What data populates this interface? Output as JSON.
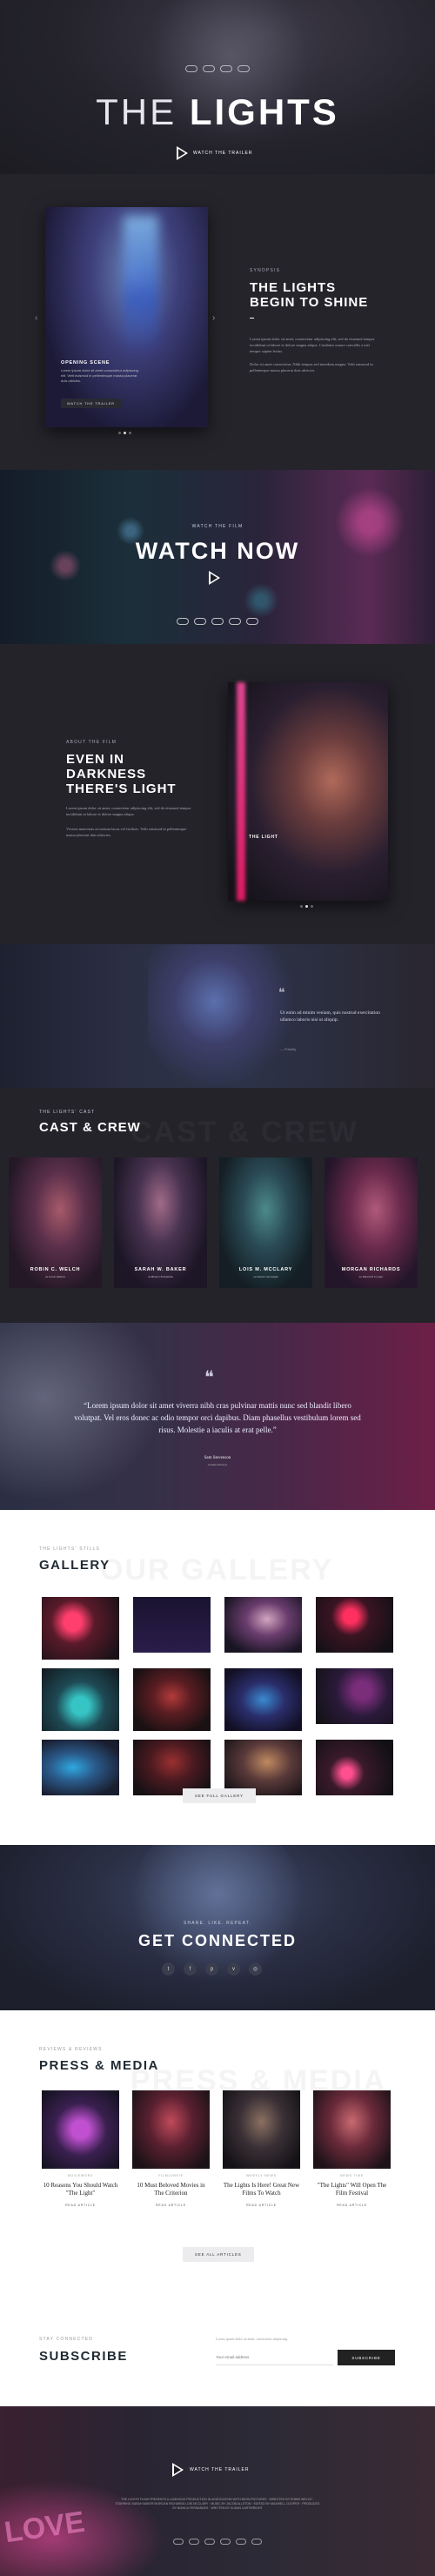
{
  "hero": {
    "title_thin": "THE",
    "title_bold": "LIGHTS",
    "trailer_label": "WATCH THE TRAILER",
    "award_count": 4
  },
  "story": {
    "eyebrow": "SYNOPSIS",
    "heading": "THE LIGHTS BEGIN TO SHINE",
    "body": [
      "Lorem ipsum dolor sit amet, consectetur adipiscing elit, sed do eiusmod tempor incididunt ut labore et dolore magna aliqua. Curabitur ornare convallis a nisl tempor sapien lectus.",
      "Dolor sit amet consectetur. Nibh tempus sed interdum magna. Velit euismod in pellentesque massa placerat duis ultricies."
    ],
    "slide": {
      "title": "OPENING SCENE",
      "desc": "Lorem ipsum dolor sit amet consectetur adipiscing elit. Velit euismod in pellentesque massa placerat duis ultricies.",
      "button": "WATCH THE TRAILER"
    },
    "dots": 3,
    "active_dot": 1
  },
  "watch": {
    "eyebrow": "WATCH THE FILM",
    "heading": "WATCH NOW",
    "award_count": 5
  },
  "about": {
    "eyebrow": "ABOUT THE FILM",
    "heading": "EVEN IN DARKNESS THERE'S LIGHT",
    "body": [
      "Lorem ipsum dolor sit amet, consectetur adipiscing elit, sed do eiusmod tempor incididunt ut labore et dolore magna aliqua.",
      "Viverra maecenas accumsan lacus vel facilisis. Velit euismod in pellentesque massa placerat duis ultricies."
    ],
    "photo_caption": "THE LIGHT",
    "dots": 3,
    "active_dot": 1
  },
  "quote1": {
    "text": "Ut enim ad minim veniam, quis nostrud exercitation ullamco laboris nisi ut aliquip.",
    "by": "— Freshly"
  },
  "cast": {
    "eyebrow": "THE LIGHTS' CAST",
    "heading": "CAST & CREW",
    "bg_word": "CAST & CREW",
    "members": [
      {
        "name": "ROBIN C. WELCH",
        "role": "as Jacob Allston"
      },
      {
        "name": "SARAH W. BAKER",
        "role": "as Bianca Fernandes"
      },
      {
        "name": "LOIS M. MCCLARY",
        "role": "as Susan Cartwright"
      },
      {
        "name": "MORGAN RICHARDS",
        "role": "as Maxwell Cooper"
      }
    ]
  },
  "quote2": {
    "text": "“Lorem ipsum dolor sit amet viverra nibh cras pulvinar mattis nunc sed blandit libero volutpat. Vel eros donec ac odio tempor orci dapibus. Diam phasellus vestibulum lorem sed risus. Molestie a iaculis at erat pelle.”",
    "by": "Sam Stevenson",
    "role": "Cinema Review"
  },
  "gallery": {
    "eyebrow": "THE LIGHTS' STILLS",
    "heading": "GALLERY",
    "bg_word": "OUR GALLERY",
    "button": "SEE FULL GALLERY"
  },
  "connect": {
    "eyebrow": "SHARE. LIKE. REPEAT.",
    "heading": "GET CONNECTED",
    "socials": [
      {
        "name": "twitter-icon",
        "glyph": "t"
      },
      {
        "name": "facebook-icon",
        "glyph": "f"
      },
      {
        "name": "pinterest-icon",
        "glyph": "p"
      },
      {
        "name": "vimeo-icon",
        "glyph": "v"
      },
      {
        "name": "instagram-icon",
        "glyph": "◎"
      }
    ]
  },
  "press": {
    "eyebrow": "REVIEWS & REVIEWS",
    "heading": "PRESS & MEDIA",
    "bg_word": "PRESS & MEDIA",
    "button": "SEE ALL ARTICLES",
    "articles": [
      {
        "source": "MOVIEWORX",
        "title": "10 Reasons You Should Watch \"The Light\"",
        "more": "READ ARTICLE"
      },
      {
        "source": "FILMJUNKIE",
        "title": "10 Must Beloved Movies in The Criterion",
        "more": "READ ARTICLE"
      },
      {
        "source": "WEEKLY NEWS",
        "title": "The Lights Is Here! Great New Films To Watch",
        "more": "READ ARTICLE"
      },
      {
        "source": "NEWS TIME",
        "title": "\"The Lights\" Will Open The Film Festival",
        "more": "READ ARTICLE"
      }
    ]
  },
  "subscribe": {
    "eyebrow": "STAY CONNECTED",
    "heading": "SUBSCRIBE",
    "note": "Lorem ipsum dolor sit amet, consectetur adipiscing.",
    "placeholder": "Your email address",
    "button": "SUBSCRIBE"
  },
  "footer": {
    "trailer_label": "WATCH THE TRAILER",
    "credits": "THE LIGHTS FILMS PRESENTS A LUMINOUS PRODUCTION IN ASSOCIATION WITH NEON PICTURES · DIRECTED BY ROBIN WELCH · STARRING SARAH BAKER MORGAN RICHARDS LOIS MCCLARY · MUSIC BY JACOB ALLSTON · EDITED BY MAXWELL COOPER · PRODUCED BY BIANCA FERNANDES · WRITTEN BY SUSAN CARTWRIGHT",
    "love_word": "LOVE",
    "award_count": 6
  }
}
